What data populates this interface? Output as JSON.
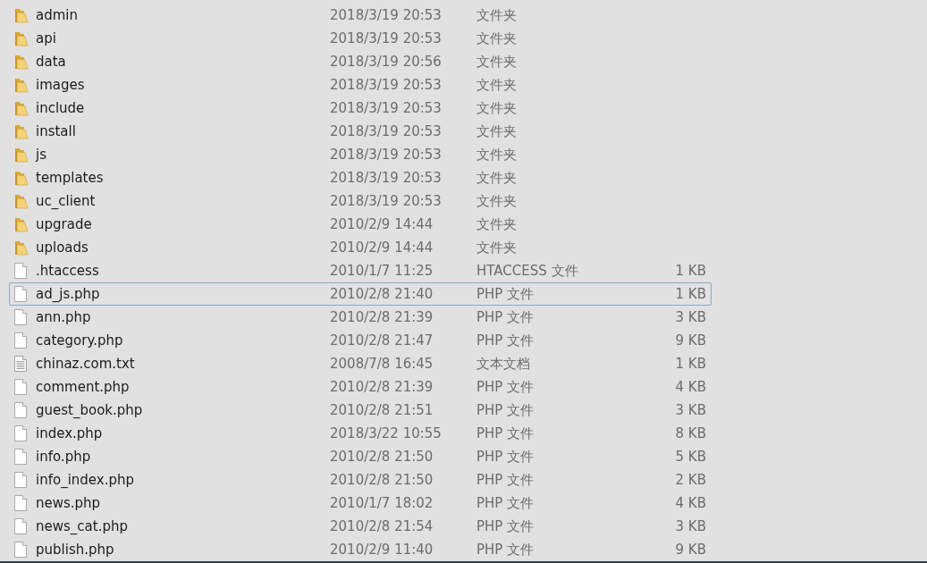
{
  "files": [
    {
      "name": "admin",
      "modified": "2018/3/19 20:53",
      "type": "文件夹",
      "kind": "folder",
      "selected": false
    },
    {
      "name": "api",
      "modified": "2018/3/19 20:53",
      "type": "文件夹",
      "kind": "folder",
      "selected": false
    },
    {
      "name": "data",
      "modified": "2018/3/19 20:56",
      "type": "文件夹",
      "kind": "folder",
      "selected": false
    },
    {
      "name": "images",
      "modified": "2018/3/19 20:53",
      "type": "文件夹",
      "kind": "folder",
      "selected": false
    },
    {
      "name": "include",
      "modified": "2018/3/19 20:53",
      "type": "文件夹",
      "kind": "folder",
      "selected": false
    },
    {
      "name": "install",
      "modified": "2018/3/19 20:53",
      "type": "文件夹",
      "kind": "folder",
      "selected": false
    },
    {
      "name": "js",
      "modified": "2018/3/19 20:53",
      "type": "文件夹",
      "kind": "folder",
      "selected": false
    },
    {
      "name": "templates",
      "modified": "2018/3/19 20:53",
      "type": "文件夹",
      "kind": "folder",
      "selected": false
    },
    {
      "name": "uc_client",
      "modified": "2018/3/19 20:53",
      "type": "文件夹",
      "kind": "folder",
      "selected": false
    },
    {
      "name": "upgrade",
      "modified": "2010/2/9 14:44",
      "type": "文件夹",
      "kind": "folder",
      "selected": false
    },
    {
      "name": "uploads",
      "modified": "2010/2/9 14:44",
      "type": "文件夹",
      "kind": "folder",
      "selected": false
    },
    {
      "name": ".htaccess",
      "modified": "2010/1/7 11:25",
      "type": "HTACCESS 文件",
      "size": "1 KB",
      "kind": "file",
      "selected": false
    },
    {
      "name": "ad_js.php",
      "modified": "2010/2/8 21:40",
      "type": "PHP 文件",
      "size": "1 KB",
      "kind": "file",
      "selected": true
    },
    {
      "name": "ann.php",
      "modified": "2010/2/8 21:39",
      "type": "PHP 文件",
      "size": "3 KB",
      "kind": "file",
      "selected": false
    },
    {
      "name": "category.php",
      "modified": "2010/2/8 21:47",
      "type": "PHP 文件",
      "size": "9 KB",
      "kind": "file",
      "selected": false
    },
    {
      "name": "chinaz.com.txt",
      "modified": "2008/7/8 16:45",
      "type": "文本文档",
      "size": "1 KB",
      "kind": "text",
      "selected": false
    },
    {
      "name": "comment.php",
      "modified": "2010/2/8 21:39",
      "type": "PHP 文件",
      "size": "4 KB",
      "kind": "file",
      "selected": false
    },
    {
      "name": "guest_book.php",
      "modified": "2010/2/8 21:51",
      "type": "PHP 文件",
      "size": "3 KB",
      "kind": "file",
      "selected": false
    },
    {
      "name": "index.php",
      "modified": "2018/3/22 10:55",
      "type": "PHP 文件",
      "size": "8 KB",
      "kind": "file",
      "selected": false
    },
    {
      "name": "info.php",
      "modified": "2010/2/8 21:50",
      "type": "PHP 文件",
      "size": "5 KB",
      "kind": "file",
      "selected": false
    },
    {
      "name": "info_index.php",
      "modified": "2010/2/8 21:50",
      "type": "PHP 文件",
      "size": "2 KB",
      "kind": "file",
      "selected": false
    },
    {
      "name": "news.php",
      "modified": "2010/1/7 18:02",
      "type": "PHP 文件",
      "size": "4 KB",
      "kind": "file",
      "selected": false
    },
    {
      "name": "news_cat.php",
      "modified": "2010/2/8 21:54",
      "type": "PHP 文件",
      "size": "3 KB",
      "kind": "file",
      "selected": false
    },
    {
      "name": "publish.php",
      "modified": "2010/2/9 11:40",
      "type": "PHP 文件",
      "size": "9 KB",
      "kind": "file",
      "selected": false
    }
  ]
}
